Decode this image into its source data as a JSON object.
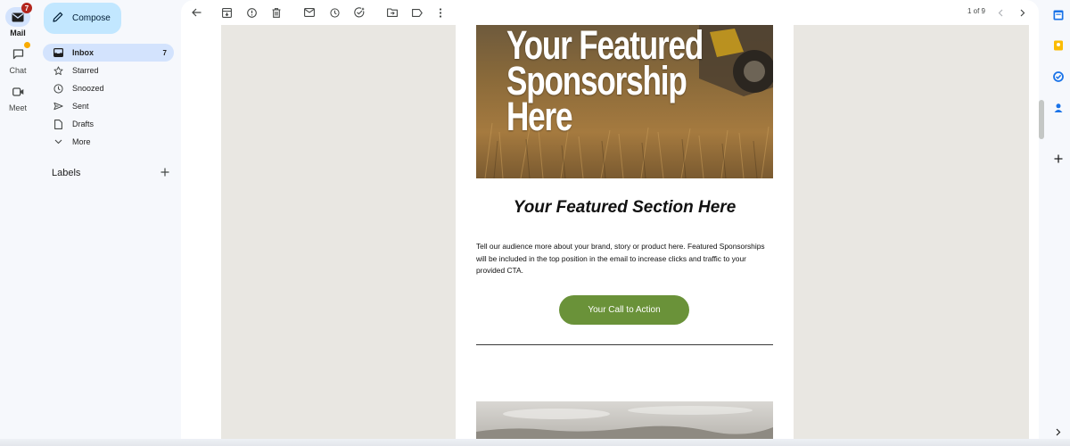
{
  "rail": {
    "mail": {
      "label": "Mail",
      "badge": "7"
    },
    "chat": {
      "label": "Chat"
    },
    "meet": {
      "label": "Meet"
    }
  },
  "nav": {
    "compose_label": "Compose",
    "items": [
      {
        "label": "Inbox",
        "count": "7",
        "icon": "inbox-icon"
      },
      {
        "label": "Starred",
        "icon": "star-icon"
      },
      {
        "label": "Snoozed",
        "icon": "clock-icon"
      },
      {
        "label": "Sent",
        "icon": "send-icon"
      },
      {
        "label": "Drafts",
        "icon": "draft-icon"
      },
      {
        "label": "More",
        "icon": "chevron-down-icon"
      }
    ],
    "labels_heading": "Labels"
  },
  "toolbar": {
    "pager": "1 of 9"
  },
  "email": {
    "hero_lines": [
      "Your Featured",
      "Sponsorship",
      "Here"
    ],
    "feature_title": "Your Featured Section Here",
    "feature_body": "Tell our audience more about your brand, story or product here. Featured Sponsorships will be included in the top position in the email to increase clicks and traffic to your provided CTA.",
    "cta_label": "Your Call to Action"
  },
  "colors": {
    "accent": "#c2e7ff",
    "active_nav": "#d3e3fd",
    "cta": "#6a9239",
    "email_bg": "#e9e7e2"
  }
}
